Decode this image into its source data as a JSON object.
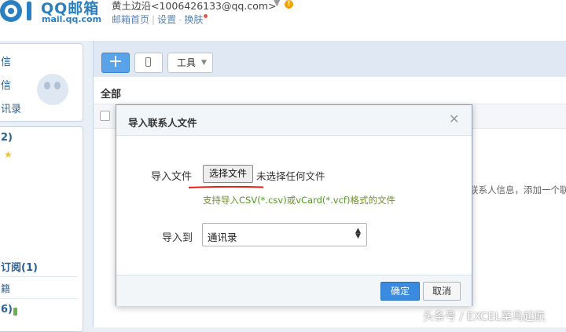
{
  "header": {
    "logo_text": "QQ邮箱",
    "logo_sub": "mail.qq.com",
    "user": "黄土边沿<1006426133@qq.com>",
    "links": [
      "邮箱首页",
      "设置",
      "换肤"
    ]
  },
  "sidebar": {
    "items": [
      "信",
      "信",
      "讯录"
    ],
    "section2_count": "2)",
    "subscription": "订阅(1)",
    "bottom_item": "籍",
    "bottom_count": "6)"
  },
  "toolbar": {
    "add_label": "+",
    "tools_label": "工具"
  },
  "main": {
    "all_label": "全部",
    "empty_hint": "联系人信息，添加一个联"
  },
  "dialog": {
    "title": "导入联系人文件",
    "file_label": "导入文件",
    "choose_file_label": "选择文件",
    "no_file_text": "未选择任何文件",
    "support_pre": "支持导入",
    "support_csv": "CSV(*.csv)",
    "support_mid": "或",
    "support_vcf": "vCard(*.vcf)",
    "support_post": "格式的文件",
    "import_to_label": "导入到",
    "target_value": "通讯录",
    "confirm_label": "确定",
    "cancel_label": "取消"
  },
  "watermark": "头条号 / EXCEL菜鸟起航",
  "colors": {
    "brand": "#2a7fc1",
    "primary_button": "#3a8be0",
    "annotation_underline": "#e0201a",
    "format_text": "#4d9a21"
  }
}
